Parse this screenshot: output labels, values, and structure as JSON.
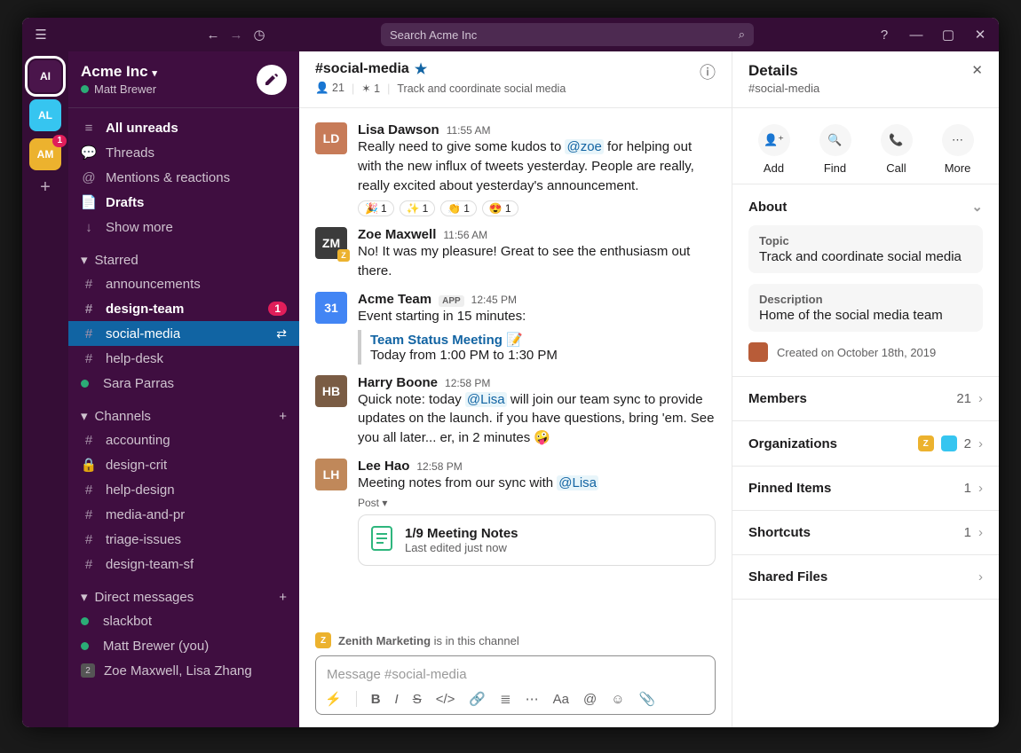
{
  "search_placeholder": "Search Acme Inc",
  "workspace_rail": [
    {
      "code": "AI",
      "color": "#4A154B",
      "active": true,
      "badge": null
    },
    {
      "code": "AL",
      "color": "#36C5F0",
      "active": false,
      "badge": null
    },
    {
      "code": "AM",
      "color": "#ECB22E",
      "active": false,
      "badge": "1"
    }
  ],
  "workspace": {
    "name": "Acme Inc",
    "user": "Matt Brewer"
  },
  "nav_top": [
    {
      "icon": "≡",
      "label": "All unreads",
      "bold": true
    },
    {
      "icon": "💬",
      "label": "Threads",
      "bold": false
    },
    {
      "icon": "@",
      "label": "Mentions & reactions",
      "bold": false
    },
    {
      "icon": "📄",
      "label": "Drafts",
      "bold": true
    },
    {
      "icon": "↓",
      "label": "Show more",
      "bold": false
    }
  ],
  "starred_label": "Starred",
  "starred": [
    {
      "prefix": "#",
      "name": "announcements",
      "bold": false
    },
    {
      "prefix": "#",
      "name": "design-team",
      "bold": true,
      "pill": "1"
    },
    {
      "prefix": "#",
      "name": "social-media",
      "selected": true,
      "trail": "⇄"
    },
    {
      "prefix": "#",
      "name": "help-desk"
    },
    {
      "prefix": "●",
      "name": "Sara Parras",
      "dot": true
    }
  ],
  "channels_label": "Channels",
  "channels": [
    {
      "prefix": "#",
      "name": "accounting"
    },
    {
      "prefix": "🔒",
      "name": "design-crit",
      "lock": true
    },
    {
      "prefix": "#",
      "name": "help-design"
    },
    {
      "prefix": "#",
      "name": "media-and-pr"
    },
    {
      "prefix": "#",
      "name": "triage-issues"
    },
    {
      "prefix": "#",
      "name": "design-team-sf"
    }
  ],
  "dm_label": "Direct messages",
  "dms": [
    {
      "prefix": "●",
      "name": "slackbot",
      "dot": true
    },
    {
      "prefix": "●",
      "name": "Matt Brewer (you)",
      "dot": true
    },
    {
      "prefix": "2",
      "name": "Zoe Maxwell, Lisa Zhang",
      "square": true
    }
  ],
  "channel": {
    "name": "#social-media",
    "members": "21",
    "shared": "1",
    "topic": "Track and coordinate social media"
  },
  "messages": [
    {
      "author": "Lisa Dawson",
      "time": "11:55 AM",
      "avatar": "#c77b58",
      "initial": "LD",
      "body_parts": [
        {
          "t": "Really need to give some kudos to "
        },
        {
          "t": "@zoe",
          "mention": true
        },
        {
          "t": " for helping out with the new influx of tweets yesterday. People are really, really excited about yesterday's announcement."
        }
      ],
      "reactions": [
        {
          "e": "🎉",
          "n": "1"
        },
        {
          "e": "✨",
          "n": "1"
        },
        {
          "e": "👏",
          "n": "1"
        },
        {
          "e": "😍",
          "n": "1"
        }
      ]
    },
    {
      "author": "Zoe Maxwell",
      "time": "11:56 AM",
      "avatar": "#3b3b3b",
      "initial": "ZM",
      "corner": "#ECB22E",
      "body_parts": [
        {
          "t": "No! It was my pleasure! Great to see the enthusiasm out there."
        }
      ]
    },
    {
      "author": "Acme Team",
      "time": "12:45 PM",
      "avatar": "#4285F4",
      "initial": "31",
      "app": true,
      "body_parts": [
        {
          "t": "Event starting in 15 minutes:"
        }
      ],
      "event": {
        "title": "Team Status Meeting",
        "emoji": "📝",
        "when": "Today from 1:00 PM to 1:30 PM"
      }
    },
    {
      "author": "Harry Boone",
      "time": "12:58 PM",
      "avatar": "#7a5c44",
      "initial": "HB",
      "body_parts": [
        {
          "t": "Quick note: today "
        },
        {
          "t": "@Lisa",
          "mention": true
        },
        {
          "t": " will join our team sync to provide updates on the launch. if you have questions, bring 'em. See you all later... er, in 2 minutes 🤪"
        }
      ]
    },
    {
      "author": "Lee Hao",
      "time": "12:58 PM",
      "avatar": "#c0885a",
      "initial": "LH",
      "body_parts": [
        {
          "t": "Meeting notes from our sync with "
        },
        {
          "t": "@Lisa",
          "mention": true
        }
      ],
      "post_label": "Post ▾",
      "attachment": {
        "title": "1/9 Meeting Notes",
        "sub": "Last edited just now"
      }
    }
  ],
  "org_banner": {
    "code": "Z",
    "color": "#ECB22E",
    "name": "Zenith Marketing",
    "rest": " is in this channel"
  },
  "composer_placeholder": "Message #social-media",
  "details": {
    "title": "Details",
    "sub": "#social-media",
    "actions": [
      {
        "label": "Add",
        "icon": "person-plus"
      },
      {
        "label": "Find",
        "icon": "search"
      },
      {
        "label": "Call",
        "icon": "phone"
      },
      {
        "label": "More",
        "icon": "dots"
      }
    ],
    "about_label": "About",
    "topic_label": "Topic",
    "topic": "Track and coordinate social media",
    "desc_label": "Description",
    "desc": "Home of the social media team",
    "created": "Created on October 18th, 2019",
    "rows": [
      {
        "label": "Members",
        "meta": "21"
      },
      {
        "label": "Organizations",
        "meta": "2",
        "orgs": true
      },
      {
        "label": "Pinned Items",
        "meta": "1"
      },
      {
        "label": "Shortcuts",
        "meta": "1"
      },
      {
        "label": "Shared Files",
        "meta": ""
      }
    ]
  },
  "app_badge": "APP"
}
